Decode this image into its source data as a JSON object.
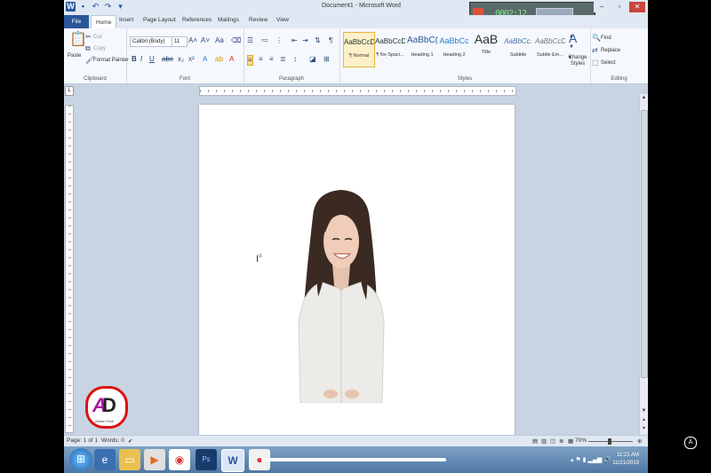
{
  "window": {
    "title": "Document1 - Microsoft Word",
    "recorder_timer": "0002:12"
  },
  "tabs": [
    "File",
    "Home",
    "Insert",
    "Page Layout",
    "References",
    "Mailings",
    "Review",
    "View"
  ],
  "ribbon": {
    "clipboard": {
      "paste": "Paste",
      "cut": "Cut",
      "copy": "Copy",
      "format_painter": "Format Painter",
      "label": "Clipboard"
    },
    "font": {
      "font_name": "Calibri (Body)",
      "font_size": "11",
      "label": "Font"
    },
    "paragraph": {
      "label": "Paragraph"
    },
    "styles": {
      "label": "Styles",
      "items": [
        {
          "preview": "AaBbCcDc",
          "name": "¶ Normal"
        },
        {
          "preview": "AaBbCcDc",
          "name": "¶ No Spaci..."
        },
        {
          "preview": "AaBbC(",
          "name": "Heading 1"
        },
        {
          "preview": "AaBbCc",
          "name": "Heading 2"
        },
        {
          "preview": "AaB",
          "name": "Title"
        },
        {
          "preview": "AaBbCc.",
          "name": "Subtitle"
        },
        {
          "preview": "AaBbCcDt",
          "name": "Subtle Em..."
        }
      ],
      "change_styles": "Change Styles"
    },
    "editing": {
      "find": "Find",
      "replace": "Replace",
      "select": "Select",
      "label": "Editing"
    }
  },
  "statusbar": {
    "page": "Page: 1 of 1",
    "words": "Words: 0",
    "zoom": "70%"
  },
  "taskbar": {
    "time": "11:21 AM",
    "date": "11/21/2019"
  },
  "overlay": {
    "logo_sub": "Adnan Tech"
  }
}
